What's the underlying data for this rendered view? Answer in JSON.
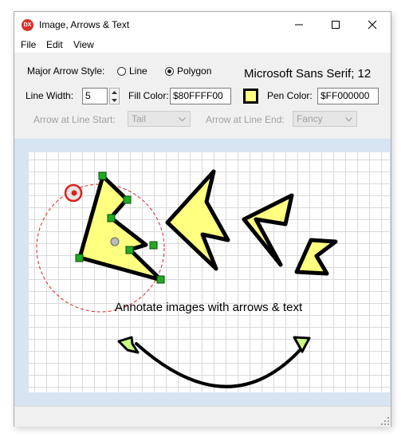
{
  "window": {
    "title": "Image, Arrows & Text",
    "app_icon_text": "DX",
    "controls": [
      "minimize",
      "maximize",
      "close"
    ]
  },
  "menu": [
    "File",
    "Edit",
    "View"
  ],
  "toolbar": {
    "arrow_style_label": "Major Arrow Style:",
    "arrow_style_options": [
      {
        "label": "Line",
        "selected": false
      },
      {
        "label": "Polygon",
        "selected": true
      }
    ],
    "font_info": "Microsoft Sans Serif; 12",
    "line_width_label": "Line Width:",
    "line_width_value": "5",
    "fill_color_label": "Fill Color:",
    "fill_color_value": "$80FFFF00",
    "pen_color_label": "Pen Color:",
    "pen_color_value": "$FF000000",
    "arrow_start_label": "Arrow at Line Start:",
    "arrow_start_value": "Tail",
    "arrow_end_label": "Arrow at Line End:",
    "arrow_end_value": "Fancy"
  },
  "canvas": {
    "caption": "Annotate images with arrows & text",
    "fill_color": "#ffff80",
    "pen_color": "#000000",
    "handle_color": "#22aa22",
    "rotation_color": "#e02020"
  },
  "icons": {
    "minimize": "minimize-icon",
    "maximize": "maximize-icon",
    "close": "close-icon",
    "spin_up": "spin-up-icon",
    "spin_down": "spin-down-icon",
    "combo": "chevron-down-icon",
    "grip": "size-grip-icon"
  }
}
